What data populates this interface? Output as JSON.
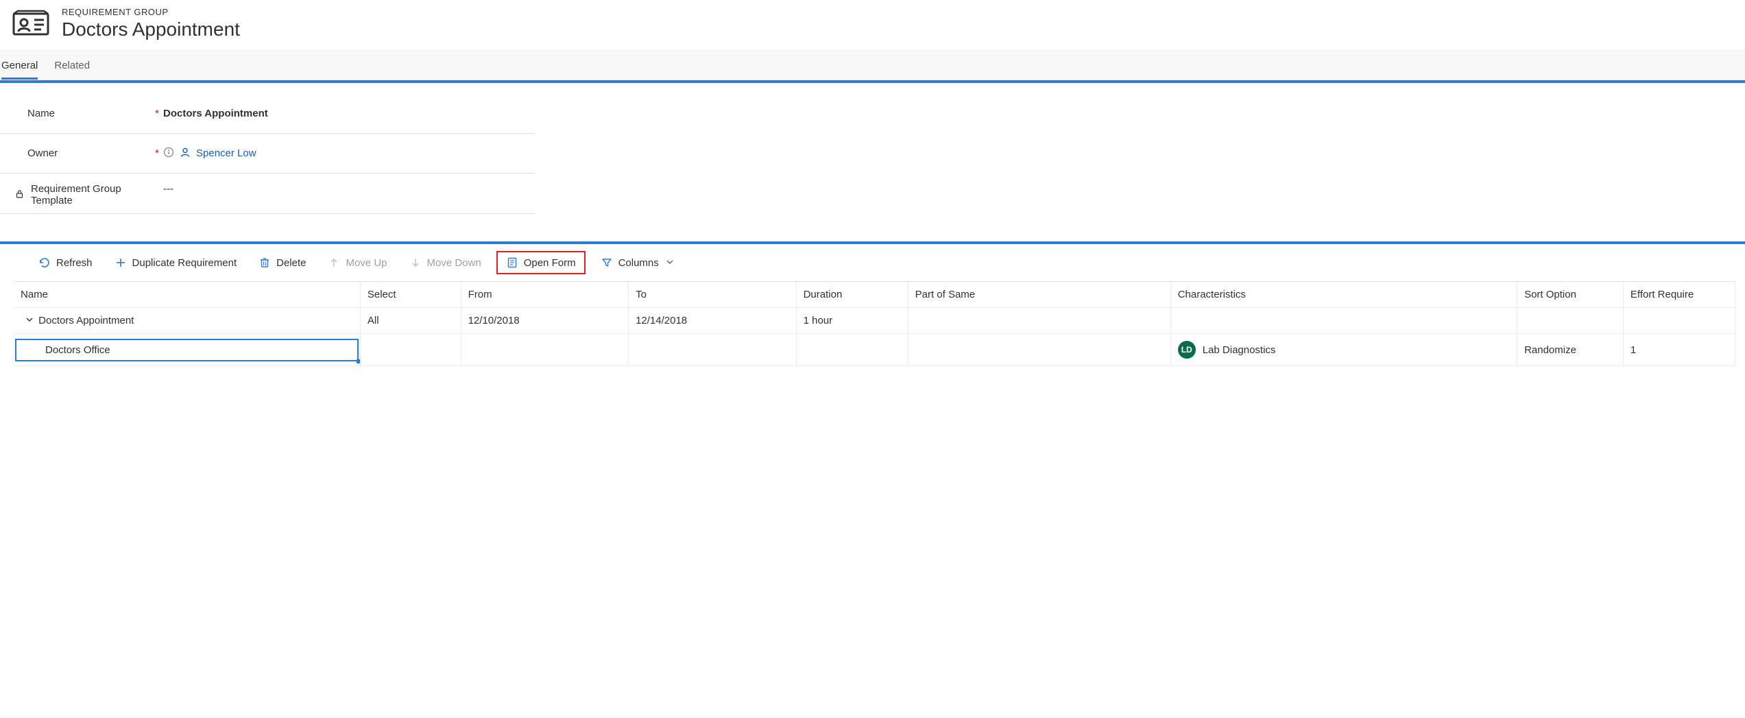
{
  "header": {
    "eyebrow": "REQUIREMENT GROUP",
    "title": "Doctors Appointment"
  },
  "tabs": {
    "items": [
      {
        "label": "General",
        "active": true
      },
      {
        "label": "Related",
        "active": false
      }
    ]
  },
  "form": {
    "name": {
      "label": "Name",
      "required": true,
      "value": "Doctors Appointment"
    },
    "owner": {
      "label": "Owner",
      "required": true,
      "value": "Spencer Low"
    },
    "template": {
      "label": "Requirement Group Template",
      "locked": true,
      "value": "---"
    }
  },
  "toolbar": {
    "refresh": "Refresh",
    "duplicate": "Duplicate Requirement",
    "delete": "Delete",
    "move_up": "Move Up",
    "move_down": "Move Down",
    "open_form": "Open Form",
    "columns": "Columns"
  },
  "grid": {
    "headers": {
      "name": "Name",
      "select": "Select",
      "from": "From",
      "to": "To",
      "duration": "Duration",
      "part_of_same": "Part of Same",
      "characteristics": "Characteristics",
      "sort_option": "Sort Option",
      "effort_required": "Effort Require"
    },
    "rows": [
      {
        "level": 0,
        "expanded": true,
        "name": "Doctors Appointment",
        "select": "All",
        "from": "12/10/2018",
        "to": "12/14/2018",
        "duration": "1 hour",
        "part_of_same": "",
        "characteristics": null,
        "sort_option": "",
        "effort_required": ""
      },
      {
        "level": 1,
        "selected": true,
        "name": "Doctors Office",
        "select": "",
        "from": "",
        "to": "",
        "duration": "",
        "part_of_same": "",
        "characteristics": {
          "badge": "LD",
          "text": "Lab Diagnostics"
        },
        "sort_option": "Randomize",
        "effort_required": "1"
      }
    ]
  },
  "colors": {
    "accent": "#2b7cd3",
    "highlight_border": "#e02020",
    "badge_bg": "#0b6a4f"
  }
}
